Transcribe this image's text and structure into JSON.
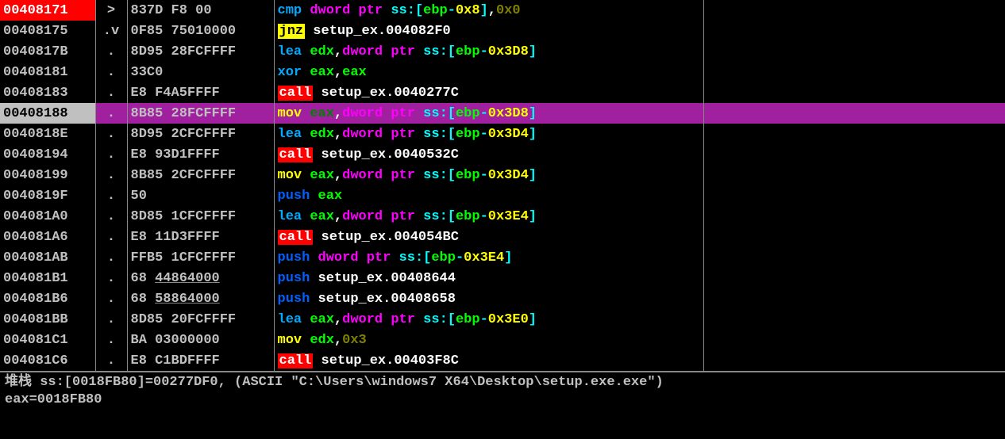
{
  "rows": [
    {
      "addr": "00408171",
      "addrClass": "addr-red",
      "mark": ">",
      "bytes": "837D F8 00",
      "tokens": [
        [
          "mn-blue",
          "cmp"
        ],
        [
          "plain",
          " "
        ],
        [
          "kw",
          "dword ptr "
        ],
        [
          "seg",
          "ss"
        ],
        [
          "br",
          ":["
        ],
        [
          "reg",
          "ebp"
        ],
        [
          "br",
          "-"
        ],
        [
          "num",
          "0x8"
        ],
        [
          "br",
          "]"
        ],
        [
          "comma",
          ","
        ],
        [
          "num-dim",
          "0x0"
        ]
      ]
    },
    {
      "addr": "00408175",
      "addrClass": "",
      "mark": ".v",
      "bytes": "0F85 75010000",
      "tokens": [
        [
          "mn-jmp",
          "jnz"
        ],
        [
          "plain",
          " setup_ex.004082F0"
        ]
      ]
    },
    {
      "addr": "0040817B",
      "addrClass": "",
      "mark": ".",
      "bytes": "8D95 28FCFFFF",
      "tokens": [
        [
          "mn-blue",
          "lea"
        ],
        [
          "plain",
          " "
        ],
        [
          "reg",
          "edx"
        ],
        [
          "comma",
          ","
        ],
        [
          "kw",
          "dword ptr "
        ],
        [
          "seg",
          "ss"
        ],
        [
          "br",
          ":["
        ],
        [
          "reg",
          "ebp"
        ],
        [
          "br",
          "-"
        ],
        [
          "num",
          "0x3D8"
        ],
        [
          "br",
          "]"
        ]
      ]
    },
    {
      "addr": "00408181",
      "addrClass": "",
      "mark": ".",
      "bytes": "33C0",
      "tokens": [
        [
          "mn-blue",
          "xor"
        ],
        [
          "plain",
          " "
        ],
        [
          "reg",
          "eax"
        ],
        [
          "comma",
          ","
        ],
        [
          "reg",
          "eax"
        ]
      ]
    },
    {
      "addr": "00408183",
      "addrClass": "",
      "mark": ".",
      "bytes": "E8 F4A5FFFF",
      "tokens": [
        [
          "mn-call",
          "call"
        ],
        [
          "plain",
          " setup_ex.0040277C"
        ]
      ]
    },
    {
      "addr": "00408188",
      "addrClass": "addr-gray",
      "mark": ".",
      "bytes": "8B85 28FCFFFF",
      "rowClass": "row-highlight",
      "tokens": [
        [
          "mn-mov",
          "mov"
        ],
        [
          "plain",
          " "
        ],
        [
          "reg-dim",
          "eax"
        ],
        [
          "comma",
          ","
        ],
        [
          "kw",
          "dword ptr "
        ],
        [
          "seg",
          "ss"
        ],
        [
          "br",
          ":["
        ],
        [
          "reg",
          "ebp"
        ],
        [
          "br",
          "-"
        ],
        [
          "num",
          "0x3D8"
        ],
        [
          "br",
          "]"
        ]
      ]
    },
    {
      "addr": "0040818E",
      "addrClass": "",
      "mark": ".",
      "bytes": "8D95 2CFCFFFF",
      "tokens": [
        [
          "mn-blue",
          "lea"
        ],
        [
          "plain",
          " "
        ],
        [
          "reg",
          "edx"
        ],
        [
          "comma",
          ","
        ],
        [
          "kw",
          "dword ptr "
        ],
        [
          "seg",
          "ss"
        ],
        [
          "br",
          ":["
        ],
        [
          "reg",
          "ebp"
        ],
        [
          "br",
          "-"
        ],
        [
          "num",
          "0x3D4"
        ],
        [
          "br",
          "]"
        ]
      ]
    },
    {
      "addr": "00408194",
      "addrClass": "",
      "mark": ".",
      "bytes": "E8 93D1FFFF",
      "tokens": [
        [
          "mn-call",
          "call"
        ],
        [
          "plain",
          " setup_ex.0040532C"
        ]
      ]
    },
    {
      "addr": "00408199",
      "addrClass": "",
      "mark": ".",
      "bytes": "8B85 2CFCFFFF",
      "tokens": [
        [
          "mn-mov",
          "mov"
        ],
        [
          "plain",
          " "
        ],
        [
          "reg",
          "eax"
        ],
        [
          "comma",
          ","
        ],
        [
          "kw",
          "dword ptr "
        ],
        [
          "seg",
          "ss"
        ],
        [
          "br",
          ":["
        ],
        [
          "reg",
          "ebp"
        ],
        [
          "br",
          "-"
        ],
        [
          "num",
          "0x3D4"
        ],
        [
          "br",
          "]"
        ]
      ]
    },
    {
      "addr": "0040819F",
      "addrClass": "",
      "mark": ".",
      "bytes": "50",
      "tokens": [
        [
          "mn-push",
          "push"
        ],
        [
          "plain",
          " "
        ],
        [
          "reg",
          "eax"
        ]
      ]
    },
    {
      "addr": "004081A0",
      "addrClass": "",
      "mark": ".",
      "bytes": "8D85 1CFCFFFF",
      "tokens": [
        [
          "mn-blue",
          "lea"
        ],
        [
          "plain",
          " "
        ],
        [
          "reg",
          "eax"
        ],
        [
          "comma",
          ","
        ],
        [
          "kw",
          "dword ptr "
        ],
        [
          "seg",
          "ss"
        ],
        [
          "br",
          ":["
        ],
        [
          "reg",
          "ebp"
        ],
        [
          "br",
          "-"
        ],
        [
          "num",
          "0x3E4"
        ],
        [
          "br",
          "]"
        ]
      ]
    },
    {
      "addr": "004081A6",
      "addrClass": "",
      "mark": ".",
      "bytes": "E8 11D3FFFF",
      "tokens": [
        [
          "mn-call",
          "call"
        ],
        [
          "plain",
          " setup_ex.004054BC"
        ]
      ]
    },
    {
      "addr": "004081AB",
      "addrClass": "",
      "mark": ".",
      "bytes": "FFB5 1CFCFFFF",
      "tokens": [
        [
          "mn-push",
          "push"
        ],
        [
          "plain",
          " "
        ],
        [
          "kw",
          "dword ptr "
        ],
        [
          "seg",
          "ss"
        ],
        [
          "br",
          ":["
        ],
        [
          "reg",
          "ebp"
        ],
        [
          "br",
          "-"
        ],
        [
          "num",
          "0x3E4"
        ],
        [
          "br",
          "]"
        ]
      ]
    },
    {
      "addr": "004081B1",
      "addrClass": "",
      "mark": ".",
      "bytes": "68 ",
      "bytesU": "44864000",
      "tokens": [
        [
          "mn-push",
          "push"
        ],
        [
          "plain",
          " setup_ex.00408644"
        ]
      ]
    },
    {
      "addr": "004081B6",
      "addrClass": "",
      "mark": ".",
      "bytes": "68 ",
      "bytesU": "58864000",
      "tokens": [
        [
          "mn-push",
          "push"
        ],
        [
          "plain",
          " setup_ex.00408658"
        ]
      ]
    },
    {
      "addr": "004081BB",
      "addrClass": "",
      "mark": ".",
      "bytes": "8D85 20FCFFFF",
      "tokens": [
        [
          "mn-blue",
          "lea"
        ],
        [
          "plain",
          " "
        ],
        [
          "reg",
          "eax"
        ],
        [
          "comma",
          ","
        ],
        [
          "kw",
          "dword ptr "
        ],
        [
          "seg",
          "ss"
        ],
        [
          "br",
          ":["
        ],
        [
          "reg",
          "ebp"
        ],
        [
          "br",
          "-"
        ],
        [
          "num",
          "0x3E0"
        ],
        [
          "br",
          "]"
        ]
      ]
    },
    {
      "addr": "004081C1",
      "addrClass": "",
      "mark": ".",
      "bytes": "BA 03000000",
      "tokens": [
        [
          "mn-mov",
          "mov"
        ],
        [
          "plain",
          " "
        ],
        [
          "reg",
          "edx"
        ],
        [
          "comma",
          ","
        ],
        [
          "num-dim",
          "0x3"
        ]
      ]
    },
    {
      "addr": "004081C6",
      "addrClass": "",
      "mark": ".",
      "bytes": "E8 C1BDFFFF",
      "tokens": [
        [
          "mn-call",
          "call"
        ],
        [
          "plain",
          " setup_ex.00403F8C"
        ]
      ]
    }
  ],
  "footer": {
    "line1": "堆栈 ss:[0018FB80]=00277DF0, (ASCII \"C:\\Users\\windows7 X64\\Desktop\\setup.exe.exe\")",
    "line2": "eax=0018FB80"
  }
}
